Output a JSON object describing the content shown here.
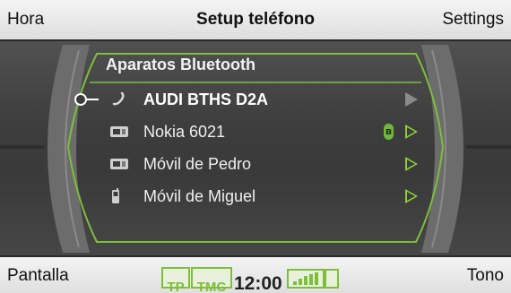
{
  "header": {
    "left": "Hora",
    "title": "Setup teléfono",
    "right": "Settings"
  },
  "panel": {
    "title": "Aparatos Bluetooth",
    "selected_index": 0,
    "items": [
      {
        "label": "AUDI BTHS D2A",
        "device_icon": "handset-icon",
        "action_icon": "play-filled-icon",
        "selected": true,
        "connected": false
      },
      {
        "label": "Nokia 6021",
        "device_icon": "phone-icon",
        "action_icon": "play-outline-icon",
        "selected": false,
        "connected": true
      },
      {
        "label": "Móvil de Pedro",
        "device_icon": "phone-icon",
        "action_icon": "play-outline-icon",
        "selected": false,
        "connected": false
      },
      {
        "label": "Móvil de Miguel",
        "device_icon": "mobile-icon",
        "action_icon": "play-outline-icon",
        "selected": false,
        "connected": false
      }
    ]
  },
  "footer": {
    "left": "Pantalla",
    "right": "Tono",
    "status": {
      "tp": "TP",
      "tmc": "TMC",
      "time": "12:00",
      "signal_icon": "signal-bars-icon",
      "sim_icon": "sim-icon"
    }
  },
  "colors": {
    "accent": "#7cbf3a",
    "background": "#3c3c3c",
    "bar": "#e8e8e8",
    "bluetooth": "#6fb83a"
  }
}
